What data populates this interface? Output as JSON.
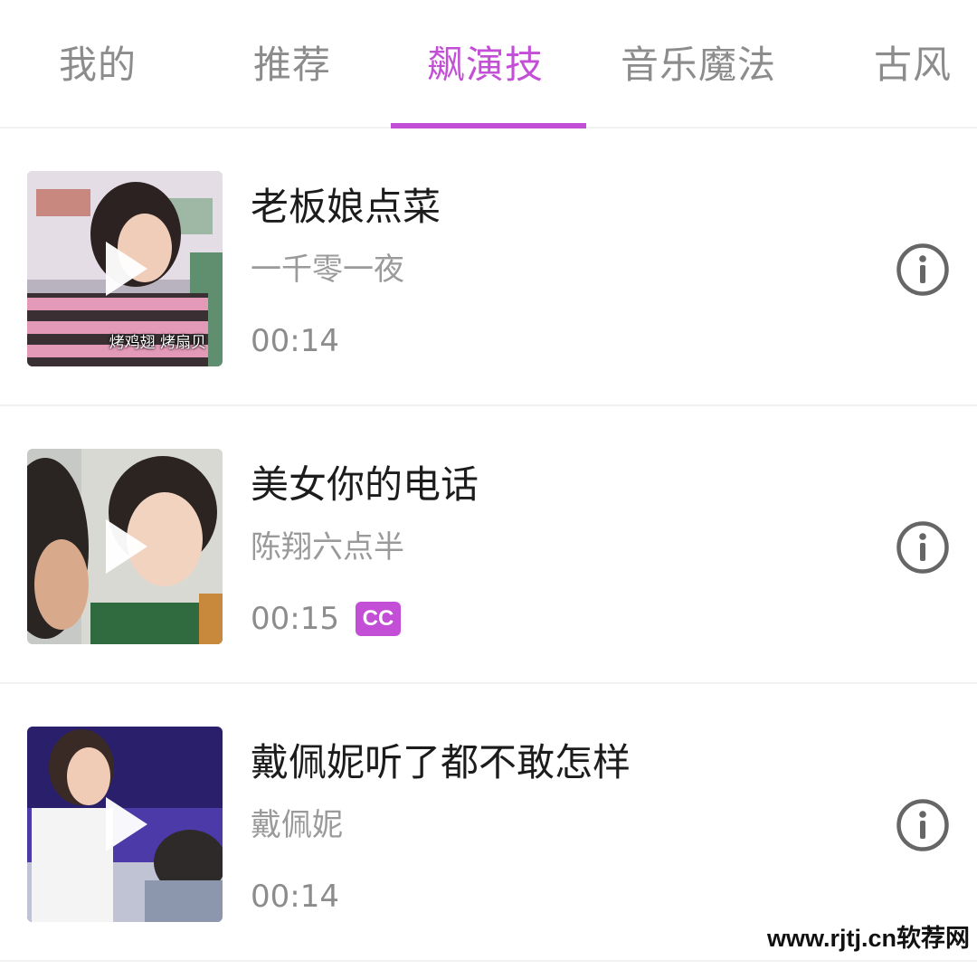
{
  "tabs": [
    {
      "label": "我的",
      "active": false
    },
    {
      "label": "推荐",
      "active": false
    },
    {
      "label": "飙演技",
      "active": true
    },
    {
      "label": "音乐魔法",
      "active": false
    },
    {
      "label": "古风",
      "active": false
    }
  ],
  "accent_color": "#c24fd6",
  "items": [
    {
      "title": "老板娘点菜",
      "artist": "一千零一夜",
      "duration": "00:14",
      "thumb_caption": "烤鸡翅 烤扇贝",
      "cc": null,
      "icons": [
        "play-icon",
        "info-icon"
      ]
    },
    {
      "title": "美女你的电话",
      "artist": "陈翔六点半",
      "duration": "00:15",
      "thumb_caption": null,
      "cc": "CC",
      "icons": [
        "play-icon",
        "info-icon"
      ]
    },
    {
      "title": "戴佩妮听了都不敢怎样",
      "artist": "戴佩妮",
      "duration": "00:14",
      "thumb_caption": null,
      "cc": null,
      "icons": [
        "play-icon",
        "info-icon"
      ]
    }
  ],
  "watermark": "www.rjtj.cn软荐网"
}
